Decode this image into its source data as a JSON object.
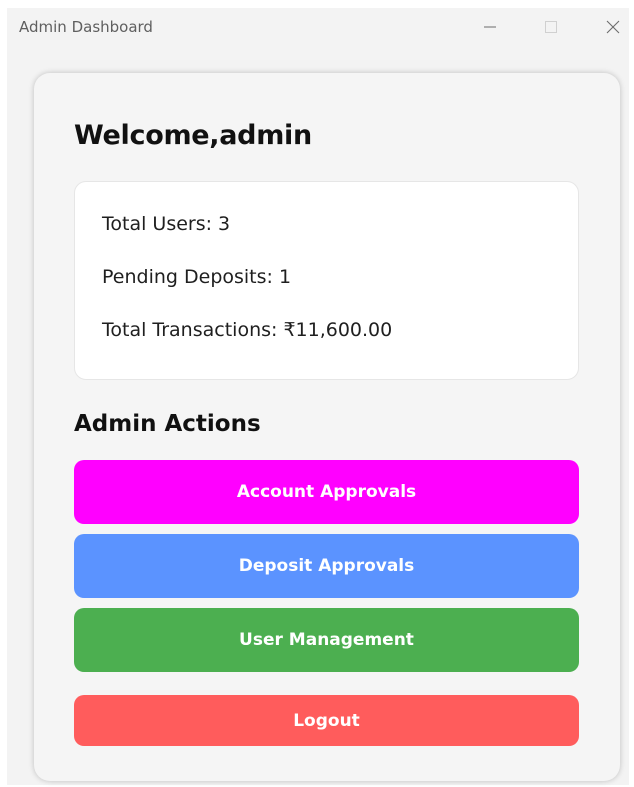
{
  "window": {
    "title": "Admin Dashboard"
  },
  "welcome": "Welcome,admin",
  "stats": {
    "total_users": "Total Users: 3",
    "pending_deposits": "Pending Deposits: 1",
    "total_transactions": "Total Transactions: ₹11,600.00"
  },
  "actions": {
    "heading": "Admin Actions",
    "account_approvals": "Account Approvals",
    "deposit_approvals": "Deposit Approvals",
    "user_management": "User Management",
    "logout": "Logout"
  },
  "colors": {
    "account_approvals": "#ff00ff",
    "deposit_approvals": "#5b93ff",
    "user_management": "#4caf50",
    "logout": "#ff5c5c"
  }
}
